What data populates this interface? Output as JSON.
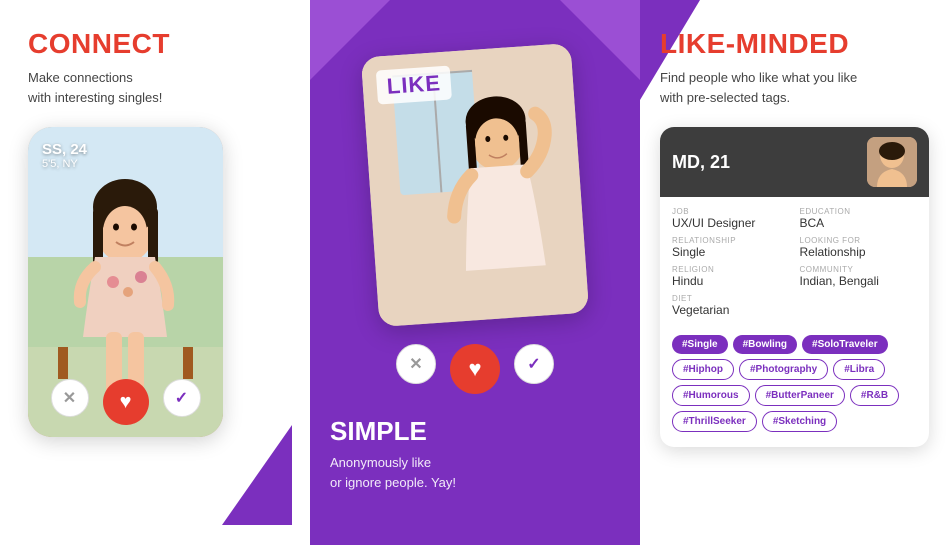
{
  "left": {
    "title": "CONNECT",
    "subtitle_line1": "Make connections",
    "subtitle_line2": "with interesting singles!",
    "profile_name": "SS, 24",
    "profile_sub": "5'5, NY",
    "btn_x": "✕",
    "btn_heart": "♥",
    "btn_check": "✓"
  },
  "middle": {
    "like_label": "LIKE",
    "title": "SIMPLE",
    "subtitle_line1": "Anonymously like",
    "subtitle_line2": "or ignore people. Yay!",
    "btn_x": "✕",
    "btn_heart": "♥",
    "btn_check": "✓"
  },
  "right": {
    "title": "LIKE-MINDED",
    "subtitle_line1": "Find people who like what you like",
    "subtitle_line2": "with pre-selected tags.",
    "profile": {
      "name": "MD, 21",
      "job_label": "JOB",
      "job_value": "UX/UI Designer",
      "edu_label": "EDUCATION",
      "edu_value": "BCA",
      "rel_label": "RELATIONSHIP",
      "rel_value": "Single",
      "looking_label": "LOOKING FOR",
      "looking_value": "Relationship",
      "religion_label": "RELIGION",
      "religion_value": "Hindu",
      "community_label": "COMMUNITY",
      "community_value": "Indian, Bengali",
      "diet_label": "DIET",
      "diet_value": "Vegetarian"
    },
    "tags": {
      "row1": [
        "#Single",
        "#Bowling",
        "#SoloTraveler"
      ],
      "row2": [
        "#Hiphop",
        "#Photography",
        "#Libra"
      ],
      "row3": [
        "#Humorous",
        "#ButterPaneer",
        "#R&B"
      ],
      "row4": [
        "#ThrillSeeker",
        "#Sketching"
      ],
      "active_tags": [
        "#Single",
        "#Bowling",
        "#SoloTraveler"
      ]
    }
  },
  "colors": {
    "purple": "#7B2FBE",
    "red": "#E63D2E",
    "white": "#ffffff",
    "dark": "#333333"
  }
}
